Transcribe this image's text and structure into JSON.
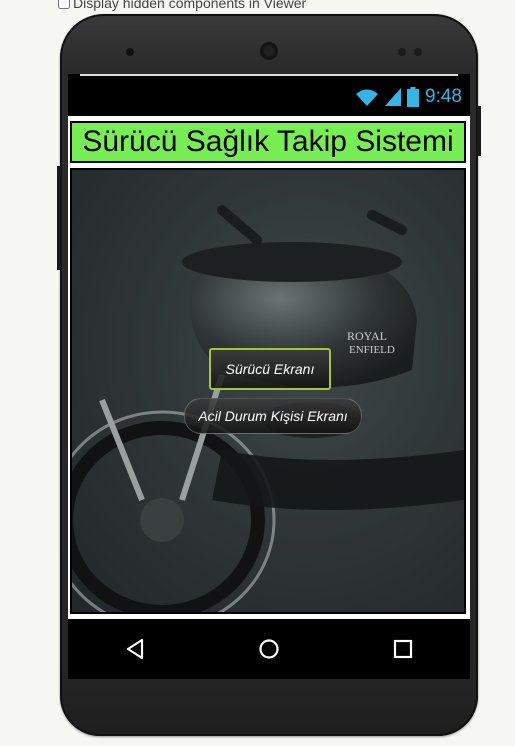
{
  "viewer_option": {
    "label": "Display hidden components in Viewer"
  },
  "status_bar": {
    "time": "9:48"
  },
  "app": {
    "title": "Sürücü Sağlık Takip Sistemi",
    "buttons": {
      "driver_screen": "Sürücü Ekranı",
      "emergency_contact_screen": "Acil Durum Kişisi Ekranı"
    },
    "bike_logo_line1": "ROYAL",
    "bike_logo_line2": "ENFIELD"
  },
  "colors": {
    "title_bg": "#76ee54",
    "status_icons": "#33b5e5",
    "selected_outline": "#a4c639"
  },
  "icons": {
    "wifi": "wifi-icon",
    "signal": "signal-icon",
    "battery": "battery-icon",
    "back": "back-nav-icon",
    "home": "home-nav-icon",
    "recents": "recents-nav-icon"
  }
}
